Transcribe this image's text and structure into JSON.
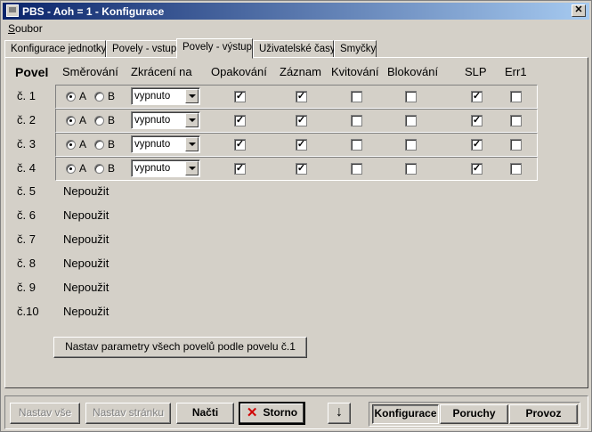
{
  "window": {
    "title": "PBS - Aoh = 1 - Konfigurace",
    "close_glyph": "✕"
  },
  "menu": {
    "items": [
      "Soubor"
    ]
  },
  "tabs": [
    "Konfigurace jednotky",
    "Povely - vstup",
    "Povely - výstup",
    "Uživatelské časy",
    "Smyčky"
  ],
  "active_tab": 2,
  "headers": {
    "povel": "Povel",
    "smerovani": "Směrování",
    "zkraceni": "Zkrácení na",
    "opakovani": "Opakování",
    "zaznam": "Záznam",
    "kvitovani": "Kvitování",
    "blokovani": "Blokování",
    "slp": "SLP",
    "err1": "Err1"
  },
  "radio_labels": {
    "a": "A",
    "b": "B"
  },
  "active_rows": [
    {
      "label": "č. 1",
      "route": "A",
      "zkraceni": "vypnuto",
      "opakovani": true,
      "zaznam": true,
      "kvitovani": false,
      "blokovani": false,
      "slp": true,
      "err1": false
    },
    {
      "label": "č. 2",
      "route": "A",
      "zkraceni": "vypnuto",
      "opakovani": true,
      "zaznam": true,
      "kvitovani": false,
      "blokovani": false,
      "slp": true,
      "err1": false
    },
    {
      "label": "č. 3",
      "route": "A",
      "zkraceni": "vypnuto",
      "opakovani": true,
      "zaznam": true,
      "kvitovani": false,
      "blokovani": false,
      "slp": true,
      "err1": false
    },
    {
      "label": "č. 4",
      "route": "A",
      "zkraceni": "vypnuto",
      "opakovani": true,
      "zaznam": true,
      "kvitovani": false,
      "blokovani": false,
      "slp": true,
      "err1": false
    }
  ],
  "unused_rows": [
    {
      "label": "č. 5",
      "status": "Nepoužit"
    },
    {
      "label": "č. 6",
      "status": "Nepoužit"
    },
    {
      "label": "č. 7",
      "status": "Nepoužit"
    },
    {
      "label": "č. 8",
      "status": "Nepoužit"
    },
    {
      "label": "č. 9",
      "status": "Nepoužit"
    },
    {
      "label": "č.10",
      "status": "Nepoužit"
    }
  ],
  "copy_button": "Nastav parametry všech povelů podle povelu č.1",
  "bottom": {
    "nastav_vse": "Nastav vše",
    "nastav_stranku": "Nastav stránku",
    "nacti": "Načti",
    "storno": "Storno",
    "konfigurace": "Konfigurace",
    "poruchy": "Poruchy",
    "provoz": "Provoz"
  },
  "checkmark": "✓"
}
